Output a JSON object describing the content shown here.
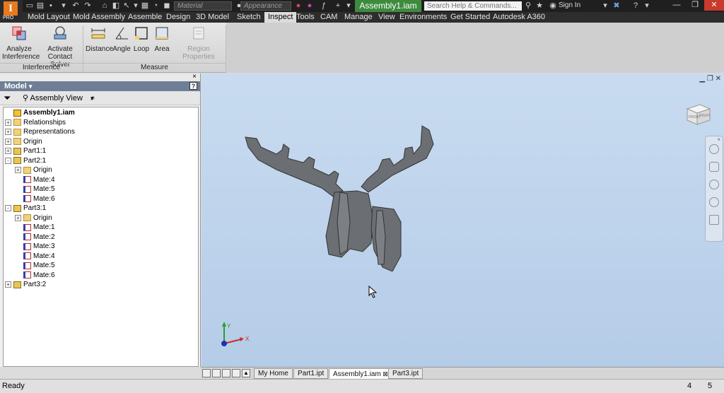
{
  "app": {
    "logo_letter": "I",
    "edition": "PRO"
  },
  "qat": {
    "material_placeholder": "Material",
    "appearance_placeholder": "Appearance"
  },
  "title": {
    "document": "Assembly1.iam",
    "search_placeholder": "Search Help & Commands...",
    "sign_in": "Sign In"
  },
  "menu": {
    "tabs": [
      "Mold Layout",
      "Mold Assembly",
      "Assemble",
      "Design",
      "3D Model",
      "Sketch",
      "Inspect",
      "Tools",
      "CAM",
      "Manage",
      "View",
      "Environments",
      "Get Started",
      "Autodesk A360"
    ],
    "active": "Inspect"
  },
  "ribbon": {
    "interference": {
      "analyze": "Analyze\nInterference",
      "analyze_l1": "Analyze",
      "analyze_l2": "Interference",
      "contact_l1": "Activate",
      "contact_l2": "Contact Solver",
      "panel_label": "Interference"
    },
    "measure": {
      "distance": "Distance",
      "angle": "Angle",
      "loop": "Loop",
      "area": "Area",
      "region": "Region Properties",
      "panel_label": "Measure"
    }
  },
  "browser": {
    "title": "Model",
    "view_mode": "Assembly View",
    "tree": [
      {
        "label": "Assembly1.iam",
        "type": "asm",
        "level": 0,
        "expander": ""
      },
      {
        "label": "Relationships",
        "type": "folder",
        "level": 0,
        "expander": "+"
      },
      {
        "label": "Representations",
        "type": "folder",
        "level": 0,
        "expander": "+"
      },
      {
        "label": "Origin",
        "type": "folder",
        "level": 0,
        "expander": "+"
      },
      {
        "label": "Part1:1",
        "type": "part",
        "level": 0,
        "expander": "+"
      },
      {
        "label": "Part2:1",
        "type": "part",
        "level": 0,
        "expander": "-"
      },
      {
        "label": "Origin",
        "type": "folder",
        "level": 1,
        "expander": "+"
      },
      {
        "label": "Mate:4",
        "type": "mate",
        "level": 1,
        "expander": ""
      },
      {
        "label": "Mate:5",
        "type": "mate",
        "level": 1,
        "expander": ""
      },
      {
        "label": "Mate:6",
        "type": "mate",
        "level": 1,
        "expander": ""
      },
      {
        "label": "Part3:1",
        "type": "part",
        "level": 0,
        "expander": "-"
      },
      {
        "label": "Origin",
        "type": "folder",
        "level": 1,
        "expander": "+"
      },
      {
        "label": "Mate:1",
        "type": "mate",
        "level": 1,
        "expander": ""
      },
      {
        "label": "Mate:2",
        "type": "mate",
        "level": 1,
        "expander": ""
      },
      {
        "label": "Mate:3",
        "type": "mate",
        "level": 1,
        "expander": ""
      },
      {
        "label": "Mate:4",
        "type": "mate",
        "level": 1,
        "expander": ""
      },
      {
        "label": "Mate:5",
        "type": "mate",
        "level": 1,
        "expander": ""
      },
      {
        "label": "Mate:6",
        "type": "mate",
        "level": 1,
        "expander": ""
      },
      {
        "label": "Part3:2",
        "type": "part",
        "level": 0,
        "expander": "+"
      }
    ]
  },
  "viewcube": {
    "front": "FRONT",
    "right": "RIGHT"
  },
  "triad": {
    "x": "X",
    "y": "Y"
  },
  "doc_tabs": [
    {
      "label": "My Home",
      "active": false
    },
    {
      "label": "Part1.ipt",
      "active": false
    },
    {
      "label": "Assembly1.iam",
      "active": true
    },
    {
      "label": "Part3.ipt",
      "active": false
    }
  ],
  "status": {
    "text": "Ready",
    "num1": "4",
    "num2": "5"
  },
  "colors": {
    "viewport_top": "#c8dbf0",
    "active_doc": "#3d8b3d",
    "model_gray": "#6b6e72"
  }
}
